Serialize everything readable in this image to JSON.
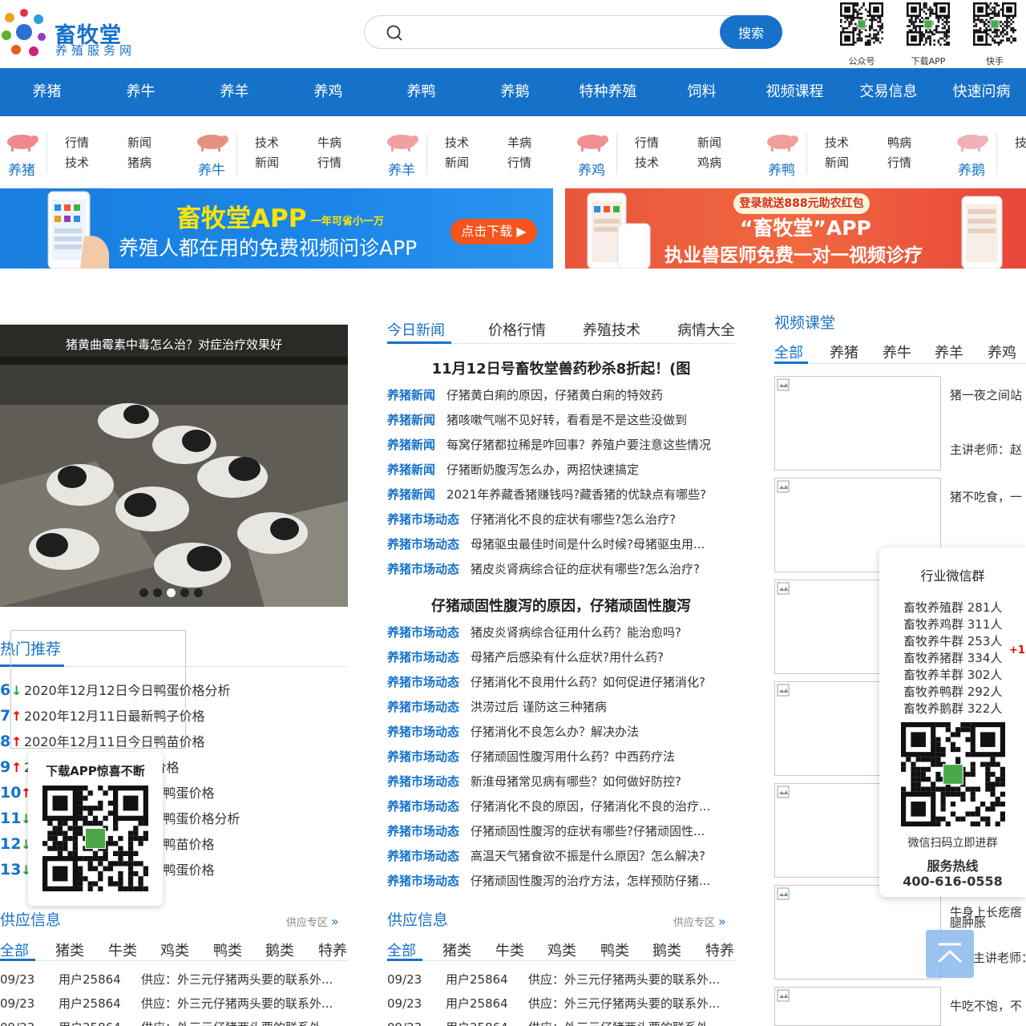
{
  "header": {
    "logo_name": "畜牧堂",
    "logo_sub": "养殖服务网",
    "search_placeholder": "",
    "search_button": "搜索",
    "qr_codes": [
      {
        "label": "公众号"
      },
      {
        "label": "下载APP"
      },
      {
        "label": "快手"
      }
    ]
  },
  "mainnav": [
    "养猪",
    "养牛",
    "养羊",
    "养鸡",
    "养鸭",
    "养鹅",
    "特种养殖",
    "饲料",
    "视频课程",
    "交易信息",
    "快速问病"
  ],
  "subnav": [
    {
      "animal": "养猪",
      "links": [
        "行情",
        "新闻",
        "技术",
        "猪病"
      ]
    },
    {
      "animal": "养牛",
      "links": [
        "技术",
        "牛病",
        "新闻",
        "行情"
      ]
    },
    {
      "animal": "养羊",
      "links": [
        "技术",
        "羊病",
        "新闻",
        "行情"
      ]
    },
    {
      "animal": "养鸡",
      "links": [
        "行情",
        "新闻",
        "技术",
        "鸡病"
      ]
    },
    {
      "animal": "养鸭",
      "links": [
        "技术",
        "鸭病",
        "新闻",
        "行情"
      ]
    },
    {
      "animal": "养鹅",
      "links": [
        "技",
        "新",
        "",
        ""
      ]
    }
  ],
  "banner1": {
    "title": "畜牧堂APP",
    "tag": "一年可省小一万",
    "subtitle": "养殖人都在用的免费视频问诊APP",
    "cta": "点击下载 ▶"
  },
  "banner2": {
    "badge": "登录就送888元助农红包",
    "title": "“畜牧堂”APP",
    "subtitle": "执业兽医师免费一对一视频诊疗"
  },
  "slider": {
    "caption": "猪黄曲霉素中毒怎么治？对症治疗效果好",
    "active_dot": 2,
    "dot_count": 5
  },
  "hot": {
    "title": "热门推荐",
    "items": [
      {
        "num": "6",
        "trend": "down",
        "text": "2020年12月12日今日鸭蛋价格分析"
      },
      {
        "num": "7",
        "trend": "up",
        "text": "2020年12月11日最新鸭子价格"
      },
      {
        "num": "8",
        "trend": "up",
        "text": "2020年12月11日今日鸭苗价格"
      },
      {
        "num": "9",
        "trend": "up",
        "text": "2020年12月11日鸭子价格"
      },
      {
        "num": "10",
        "trend": "up",
        "text": "2020年12月10日今日鸭蛋价格"
      },
      {
        "num": "11",
        "trend": "down",
        "text": "2020年12月10日今日鸭蛋价格分析"
      },
      {
        "num": "12",
        "trend": "down",
        "text": "2020年12月10日今日鸭苗价格"
      },
      {
        "num": "13",
        "trend": "down",
        "text": "2020年12月09日今日鸭蛋价格"
      }
    ]
  },
  "download_popup": {
    "title": "下载APP惊喜不断"
  },
  "news": {
    "tabs": [
      "今日新闻",
      "价格行情",
      "养殖技术",
      "病情大全"
    ],
    "active_tab": 0,
    "head1": "11月12日号畜牧堂兽药秒杀8折起！(图",
    "group1": [
      {
        "cat": "养猪新闻",
        "title": "仔猪黄白痢的原因，仔猪黄白痢的特效药"
      },
      {
        "cat": "养猪新闻",
        "title": "猪咳嗽气喘不见好转，看看是不是这些没做到"
      },
      {
        "cat": "养猪新闻",
        "title": "每窝仔猪都拉稀是咋回事？养殖户要注意这些情况"
      },
      {
        "cat": "养猪新闻",
        "title": "仔猪断奶腹泻怎么办，两招快速搞定"
      },
      {
        "cat": "养猪新闻",
        "title": "2021年养藏香猪赚钱吗?藏香猪的优缺点有哪些?"
      },
      {
        "cat": "养猪市场动态",
        "title": "仔猪消化不良的症状有哪些?怎么治疗?"
      },
      {
        "cat": "养猪市场动态",
        "title": "母猪驱虫最佳时间是什么时候?母猪驱虫用..."
      },
      {
        "cat": "养猪市场动态",
        "title": "猪皮炎肾病综合征的症状有哪些?怎么治疗?"
      }
    ],
    "head2": "仔猪顽固性腹泻的原因，仔猪顽固性腹泻",
    "group2": [
      {
        "cat": "养猪市场动态",
        "title": "猪皮炎肾病综合征用什么药？能治愈吗?"
      },
      {
        "cat": "养猪市场动态",
        "title": "母猪产后感染有什么症状?用什么药?"
      },
      {
        "cat": "养猪市场动态",
        "title": "仔猪消化不良用什么药？如何促进仔猪消化?"
      },
      {
        "cat": "养猪市场动态",
        "title": "洪涝过后 谨防这三种猪病"
      },
      {
        "cat": "养猪市场动态",
        "title": "仔猪消化不良怎么办？解决办法"
      },
      {
        "cat": "养猪市场动态",
        "title": "仔猪顽固性腹泻用什么药？中西药疗法"
      },
      {
        "cat": "养猪市场动态",
        "title": "新淮母猪常见病有哪些？如何做好防控?"
      },
      {
        "cat": "养猪市场动态",
        "title": "仔猪消化不良的原因，仔猪消化不良的治疗..."
      },
      {
        "cat": "养猪市场动态",
        "title": "仔猪顽固性腹泻的症状有哪些?仔猪顽固性..."
      },
      {
        "cat": "养猪市场动态",
        "title": "高温天气猪食欲不振是什么原因？怎么解决?"
      },
      {
        "cat": "养猪市场动态",
        "title": "仔猪顽固性腹泻的治疗方法，怎样预防仔猪..."
      }
    ]
  },
  "supply_left": {
    "title": "供应信息",
    "more": "供应专区",
    "tabs": [
      "全部",
      "猪类",
      "牛类",
      "鸡类",
      "鸭类",
      "鹅类",
      "特养"
    ],
    "rows": [
      {
        "date": "09/23",
        "user": "用户25864",
        "text": "供应：外三元仔猪两头要的联系外..."
      },
      {
        "date": "09/23",
        "user": "用户25864",
        "text": "供应：外三元仔猪两头要的联系外..."
      },
      {
        "date": "09/23",
        "user": "用户25864",
        "text": "供应：外三元仔猪两头要的联系外..."
      }
    ]
  },
  "supply_right": {
    "title": "供应信息",
    "more": "供应专区",
    "tabs": [
      "全部",
      "猪类",
      "牛类",
      "鸡类",
      "鸭类",
      "鹅类",
      "特养"
    ],
    "rows": [
      {
        "date": "09/23",
        "user": "用户25864",
        "text": "供应：外三元仔猪两头要的联系外..."
      },
      {
        "date": "09/23",
        "user": "用户25864",
        "text": "供应：外三元仔猪两头要的联系外..."
      },
      {
        "date": "09/23",
        "user": "用户25864",
        "text": "供应：外三元仔猪两头要的联系外..."
      }
    ]
  },
  "video": {
    "title": "视频课堂",
    "tabs": [
      "全部",
      "养猪",
      "养牛",
      "养羊",
      "养鸡"
    ],
    "items": [
      {
        "line1": "猪一夜之间站",
        "line2": "主讲老师：赵"
      },
      {
        "line1": "猪不吃食，一",
        "line2": ""
      },
      {
        "line1": "",
        "line2": ""
      },
      {
        "line1": "",
        "line2": ""
      },
      {
        "line1": "",
        "line2": ""
      },
      {
        "line1": "牛身上长疙瘩",
        "line2": "腿肿胀"
      },
      {
        "line1": "牛吃不饱，不",
        "line2": ""
      }
    ],
    "extra_line": "主讲老师：赵"
  },
  "wechat": {
    "title": "行业微信群",
    "groups": [
      "畜牧养殖群 281人",
      "畜牧养鸡群 311人",
      "畜牧养牛群 253人",
      "畜牧养猪群 334人",
      "畜牧养羊群 302人",
      "畜牧养鸭群 292人",
      "畜牧养鹅群 322人"
    ],
    "scan": "微信扫码立即进群",
    "hotline_label": "服务热线",
    "phone": "400-616-0558",
    "plus": "+1"
  },
  "colors": {
    "brand": "#1672c9",
    "up": "#e00000",
    "down": "#2a9d3a"
  }
}
